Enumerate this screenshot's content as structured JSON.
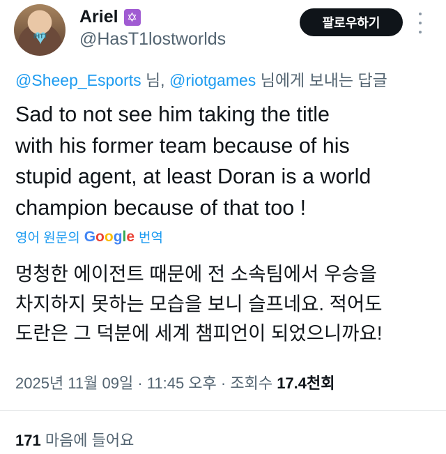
{
  "user": {
    "name": "Ariel",
    "badge_icon": "star-of-david-icon",
    "badge_glyph": "✡",
    "handle": "@HasT1lostworlds",
    "avatar_heart_text": "IHTT"
  },
  "header": {
    "follow_label": "팔로우하기",
    "more_icon": "more-vertical-icon"
  },
  "reply": {
    "mention1": "@Sheep_Esports",
    "sep1": " 님, ",
    "mention2": "@riotgames",
    "suffix": " 님에게 보내는 답글"
  },
  "tweet": {
    "lines": [
      "Sad to not see him taking the title",
      "with his former team because of his",
      "stupid agent, at least Doran is a world",
      "champion because of that too !"
    ]
  },
  "translation": {
    "prefix": "영어 원문의",
    "brand": "Google",
    "suffix": "번역",
    "lines": [
      "멍청한 에이전트 때문에 전 소속팀에서 우승을",
      "차지하지 못하는 모습을 보니 슬프네요. 적어도",
      "도란은 그 덕분에 세계 챔피언이 되었으니까요!"
    ]
  },
  "meta": {
    "date": "2025년 11월 09일",
    "dot1": " · ",
    "time": "11:45 오후",
    "dot2": " · ",
    "views_label": "조회수 ",
    "views_value": "17.4천회"
  },
  "likes": {
    "count": "171",
    "label": " 마음에 들어요"
  },
  "colors": {
    "accent": "#1d9bf0",
    "text": "#0f1419",
    "muted": "#536471",
    "badge": "#a05bd2"
  }
}
